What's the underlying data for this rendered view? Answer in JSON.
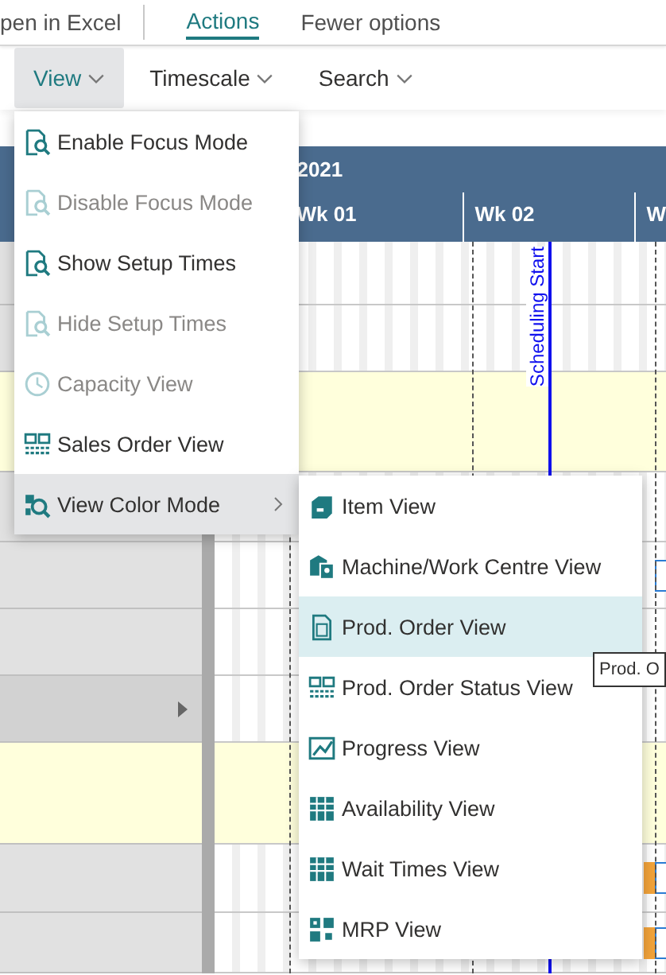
{
  "command_bar": {
    "items": [
      {
        "label": "pen in Excel",
        "selected": false
      },
      {
        "label": "Actions",
        "selected": true
      },
      {
        "label": "Fewer options",
        "selected": false
      }
    ]
  },
  "toolbar": {
    "menus": [
      {
        "label": "View",
        "selected": true
      },
      {
        "label": "Timescale",
        "selected": false
      },
      {
        "label": "Search",
        "selected": false
      }
    ]
  },
  "gantt": {
    "year": "2021",
    "weeks": [
      "Wk 01",
      "Wk 02",
      "W"
    ],
    "marker": "Scheduling Start",
    "rows": [
      {
        "kind": "plain",
        "selected": false,
        "bars": []
      },
      {
        "kind": "plain",
        "selected": false,
        "bars": []
      },
      {
        "kind": "highlight",
        "selected": false,
        "bars": []
      },
      {
        "kind": "plain",
        "selected": false,
        "bars": []
      },
      {
        "kind": "plain",
        "selected": false,
        "bars": [
          {
            "color": "#2b7cd3"
          }
        ]
      },
      {
        "kind": "plain",
        "selected": false,
        "bars": []
      },
      {
        "kind": "plain",
        "selected": true,
        "bars": []
      },
      {
        "kind": "highlight",
        "selected": false,
        "bars": []
      },
      {
        "kind": "plain",
        "selected": false,
        "bars": [
          {
            "color": "#f2a33a"
          },
          {
            "color": "#2b7cd3"
          }
        ]
      },
      {
        "kind": "plain",
        "selected": false,
        "bars": [
          {
            "color": "#f2a33a"
          },
          {
            "color": "#2b7cd3"
          }
        ]
      }
    ]
  },
  "view_menu": {
    "items": [
      {
        "label": "Enable Focus Mode",
        "disabled": false,
        "selected": false,
        "has_submenu": false
      },
      {
        "label": "Disable Focus Mode",
        "disabled": true,
        "selected": false,
        "has_submenu": false
      },
      {
        "label": "Show Setup Times",
        "disabled": false,
        "selected": false,
        "has_submenu": false
      },
      {
        "label": "Hide Setup Times",
        "disabled": true,
        "selected": false,
        "has_submenu": false
      },
      {
        "label": "Capacity View",
        "disabled": true,
        "selected": false,
        "has_submenu": false
      },
      {
        "label": "Sales Order View",
        "disabled": false,
        "selected": false,
        "has_submenu": false
      },
      {
        "label": "View Color Mode",
        "disabled": false,
        "selected": true,
        "has_submenu": true
      }
    ]
  },
  "color_mode_menu": {
    "items": [
      {
        "label": "Item View",
        "selected": false
      },
      {
        "label": "Machine/Work Centre View",
        "selected": false
      },
      {
        "label": "Prod. Order View",
        "selected": true
      },
      {
        "label": "Prod. Order Status View",
        "selected": false
      },
      {
        "label": "Progress View",
        "selected": false
      },
      {
        "label": "Availability View",
        "selected": false
      },
      {
        "label": "Wait Times View",
        "selected": false
      },
      {
        "label": "MRP View",
        "selected": false
      }
    ]
  },
  "tooltip": "Prod. O"
}
